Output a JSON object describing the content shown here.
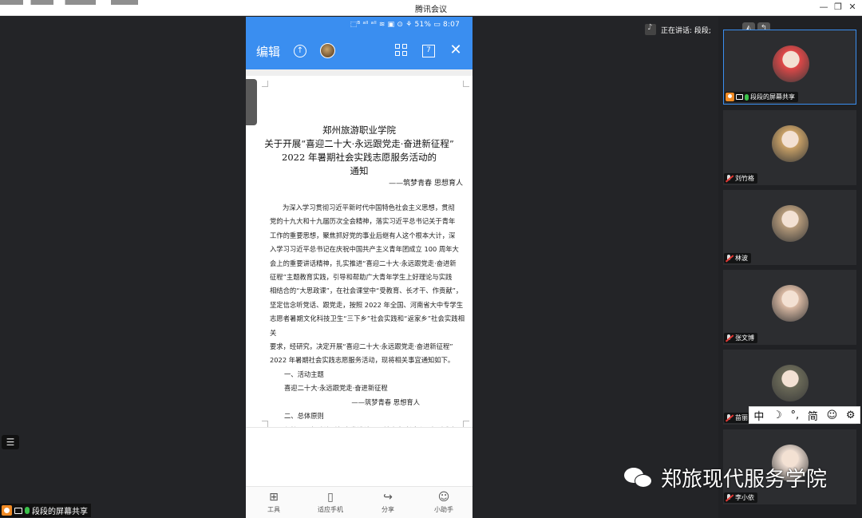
{
  "window": {
    "title": "腾讯会议",
    "controls": [
      "—",
      "❐",
      "✕"
    ]
  },
  "phone": {
    "status_text": "⬚ᴮ ᵃˡˡ ᵃˡˡ ≋ ▣ ⊙ ⚘ 51% ▭ 8:07",
    "topbar": {
      "edit_label": "编辑",
      "page_count": "7",
      "icons": [
        "upload-icon",
        "avatar",
        "grid-icon",
        "close-icon"
      ]
    },
    "document": {
      "title_lines": [
        "郑州旅游职业学院",
        "关于开展“喜迎二十大·永远跟党走·奋进新征程”",
        "2022 年暑期社会实践志愿服务活动的",
        "通知"
      ],
      "subtitle": "——筑梦青春  思想育人",
      "paragraph_lines": [
        "为深入学习贯彻习近平新时代中国特色社会主义思想，贯彻",
        "党的十九大和十九届历次全会精神，落实习近平总书记关于青年",
        "工作的重要思想，聚焦抓好党的事业后继有人这个根本大计，深",
        "入学习习近平总书记在庆祝中国共产主义青年团成立 100 周年大",
        "会上的重要讲话精神，扎实推进“喜迎二十大·永远跟党走·奋进新",
        "征程”主题教育实践，引导和帮助广大青年学生上好理论与实践",
        "相结合的“大思政课”，在社会课堂中“受教育、长才干、作贡献”，",
        "坚定信念听党话、跟党走，按照 2022 年全国、河南省大中专学生",
        "志愿者暑期文化科技卫生“三下乡”社会实践和“返家乡”社会实践相关",
        "要求，经研究，决定开展“喜迎二十大·永远跟党走·奋进新征程”",
        "2022 年暑期社会实践志愿服务活动，现将相关事宜通知如下。"
      ],
      "section1_heading": "一、活动主题",
      "section1_theme": "喜迎二十大·永远跟党走·奋进新征程",
      "section1_subtheme": "——筑梦青春  思想育人",
      "section2_heading": "二、总体原则",
      "section2_text": "坚持从思想政治引领出发设计开展社会实践活动，在形式内"
    },
    "toolbar": [
      {
        "icon": "tools-icon",
        "glyph": "⊞",
        "label": "工具"
      },
      {
        "icon": "phone-fit-icon",
        "glyph": "▯",
        "label": "适应手机"
      },
      {
        "icon": "share-icon",
        "glyph": "↪",
        "label": "分享"
      },
      {
        "icon": "assistant-icon",
        "glyph": "☺",
        "label": "小助手"
      }
    ]
  },
  "share_tag": "段段的屏幕共享",
  "speaking": {
    "text": "正在讲话: 段段;"
  },
  "participants": [
    {
      "name": "段段的屏幕共享",
      "active": true,
      "mic": "on",
      "avatar_color": "#e04848"
    },
    {
      "name": "刘竹格",
      "active": false,
      "mic": "off",
      "avatar_color": "#c8a066"
    },
    {
      "name": "林波",
      "active": false,
      "mic": "off",
      "avatar_color": "#b59a7a"
    },
    {
      "name": "张文博",
      "active": false,
      "mic": "off",
      "avatar_color": "#d8b8a2"
    },
    {
      "name": "苗丽",
      "active": false,
      "mic": "off",
      "avatar_color": "#6b6a58"
    },
    {
      "name": "李小依",
      "active": false,
      "mic": "off",
      "avatar_color": "#e7d7cc"
    }
  ],
  "ime": [
    "中",
    "☽",
    "°,",
    "简",
    "☺",
    "⚙"
  ],
  "watermark": "郑旅现代服务学院"
}
